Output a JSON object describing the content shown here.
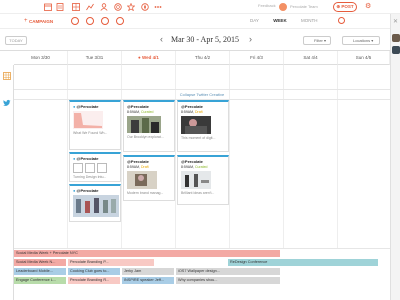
{
  "topbar": {
    "icons": [
      "calendar-icon",
      "list-icon",
      "grid-icon",
      "chart-icon",
      "people-icon",
      "radar-icon",
      "star-icon",
      "compass-icon",
      "dots-icon"
    ],
    "user_name": "Feedback",
    "org_name": "Percolate Team",
    "post_label": "POST"
  },
  "subbar": {
    "campaign_label": "CAMPAIGN",
    "view_tabs": [
      "DAY",
      "WEEK",
      "MONTH"
    ],
    "active_view": "WEEK"
  },
  "toolbar": {
    "today_label": "TODAY",
    "date_range": "Mar 30 - Apr 5, 2015",
    "filter_label": "Filter",
    "locations_label": "Locations"
  },
  "days": [
    {
      "label": "Mon 3/30",
      "today": false
    },
    {
      "label": "Tue 3/31",
      "today": false
    },
    {
      "label": "Wed 4/1",
      "today": true
    },
    {
      "label": "Thu 4/2",
      "today": false
    },
    {
      "label": "Fri 4/3",
      "today": false
    },
    {
      "label": "Sat 4/4",
      "today": false
    },
    {
      "label": "Sun 4/5",
      "today": false
    }
  ],
  "collapse_label": "Collapse Twitter Creative",
  "cards": {
    "tue1": {
      "handle": "@Percolate",
      "body": "What We Found Wh..."
    },
    "tue2": {
      "handle": "@Percolate",
      "body": "Turning Design Intu..."
    },
    "tue3": {
      "handle": "@Percolate",
      "body": ""
    },
    "wed1": {
      "handle": "@Percolate",
      "time": "8:59AM,",
      "status": "Curated",
      "body": "Our Brooklyn explorat..."
    },
    "wed2": {
      "handle": "@Percolate",
      "time": "8:59AM,",
      "status": "Draft",
      "body": "Modern brand manag..."
    },
    "thu1": {
      "handle": "@Percolate",
      "time": "8:59AM,",
      "status": "Draft",
      "body": "This moment of digit..."
    },
    "thu2": {
      "handle": "@Percolate",
      "time": "8:59AM,",
      "status": "Curated",
      "body": "Brilliant ideas aren't..."
    }
  },
  "bars": {
    "row1": [
      "Social Media Week + Percolate NYC"
    ],
    "row2a": "Social Media Week N...",
    "row2b": "Percolate Branding P...",
    "row2c": "ReDesign Conference",
    "row3a": "Leaderboard Mobile...",
    "row3b": "Cooking Club goes to...",
    "row3c": "Jerky Jam",
    "row3d": "iOS7 Wallpaper design...",
    "row4a": "Engage Conference L...",
    "row4b": "Percolate Branding R...",
    "row4c": "INSPIRE speaker Jeff...",
    "row4d": "Why companies shou..."
  },
  "colors": {
    "accent": "#e65c3c",
    "twitter": "#38a3d6",
    "curated": "#8bb72a",
    "draft": "#e8a700",
    "bar_pink": "#f3a9a4",
    "bar_lightpink": "#f8c9c4",
    "bar_teal": "#9fd3d8",
    "bar_blue": "#a9cde6",
    "bar_green": "#b8dcaa",
    "bar_gray": "#d7d7d7"
  }
}
